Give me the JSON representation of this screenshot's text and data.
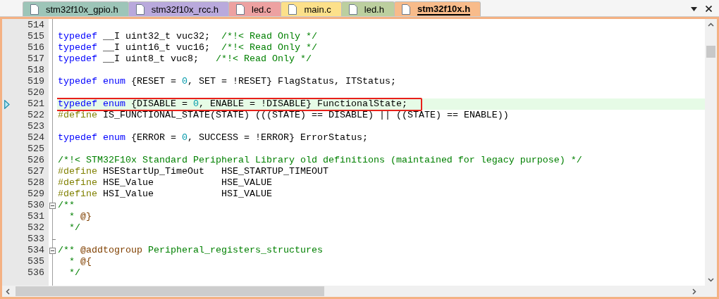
{
  "tabs": [
    {
      "label": "stm32f10x_gpio.h",
      "color": "#9dc5b8",
      "selected": false
    },
    {
      "label": "stm32f10x_rcc.h",
      "color": "#b9a9dc",
      "selected": false
    },
    {
      "label": "led.c",
      "color": "#eda1a1",
      "selected": false
    },
    {
      "label": "main.c",
      "color": "#fce08a",
      "selected": false
    },
    {
      "label": "led.h",
      "color": "#bccf9f",
      "selected": false
    },
    {
      "label": "stm32f10x.h",
      "color": "#f8bb8a",
      "selected": true
    }
  ],
  "lines": [
    {
      "number": "514",
      "current": false
    },
    {
      "number": "515",
      "current": false,
      "tokens": [
        {
          "text": "typedef",
          "kind": "keyword"
        },
        {
          "text": " __I uint32_t vuc32;  ",
          "kind": "plain"
        },
        {
          "text": "/*!< Read Only */",
          "kind": "comment"
        }
      ]
    },
    {
      "number": "516",
      "current": false,
      "tokens": [
        {
          "text": "typedef",
          "kind": "keyword"
        },
        {
          "text": " __I uint16_t vuc16;  ",
          "kind": "plain"
        },
        {
          "text": "/*!< Read Only */",
          "kind": "comment"
        }
      ]
    },
    {
      "number": "517",
      "current": false,
      "tokens": [
        {
          "text": "typedef",
          "kind": "keyword"
        },
        {
          "text": " __I uint8_t vuc8;   ",
          "kind": "plain"
        },
        {
          "text": "/*!< Read Only */",
          "kind": "comment"
        }
      ]
    },
    {
      "number": "518",
      "current": false
    },
    {
      "number": "519",
      "current": false,
      "tokens": [
        {
          "text": "typedef enum",
          "kind": "keyword"
        },
        {
          "text": " {RESET = ",
          "kind": "plain"
        },
        {
          "text": "0",
          "kind": "number"
        },
        {
          "text": ", SET = !RESET} FlagStatus, ITStatus;",
          "kind": "plain"
        }
      ]
    },
    {
      "number": "520",
      "current": false
    },
    {
      "number": "521",
      "current": true,
      "tokens": [
        {
          "text": "typedef enum",
          "kind": "keyword"
        },
        {
          "text": " {DISABLE = ",
          "kind": "plain"
        },
        {
          "text": "0",
          "kind": "number"
        },
        {
          "text": ", ENABLE = !DISABLE} FunctionalState;",
          "kind": "plain"
        }
      ]
    },
    {
      "number": "522",
      "current": false,
      "tokens": [
        {
          "text": "#define",
          "kind": "preprocessor"
        },
        {
          "text": " IS_FUNCTIONAL_STATE(STATE) (((STATE) == DISABLE) || ((STATE) == ENABLE))",
          "kind": "plain"
        }
      ]
    },
    {
      "number": "523",
      "current": false
    },
    {
      "number": "524",
      "current": false,
      "tokens": [
        {
          "text": "typedef enum",
          "kind": "keyword"
        },
        {
          "text": " {ERROR = ",
          "kind": "plain"
        },
        {
          "text": "0",
          "kind": "number"
        },
        {
          "text": ", SUCCESS = !ERROR} ErrorStatus;",
          "kind": "plain"
        }
      ]
    },
    {
      "number": "525",
      "current": false
    },
    {
      "number": "526",
      "current": false,
      "tokens": [
        {
          "text": "/*!< STM32F10x Standard Peripheral Library old definitions (maintained for legacy purpose) */",
          "kind": "comment"
        }
      ]
    },
    {
      "number": "527",
      "current": false,
      "tokens": [
        {
          "text": "#define",
          "kind": "preprocessor"
        },
        {
          "text": " HSEStartUp_TimeOut   HSE_STARTUP_TIMEOUT",
          "kind": "plain"
        }
      ]
    },
    {
      "number": "528",
      "current": false,
      "tokens": [
        {
          "text": "#define",
          "kind": "preprocessor"
        },
        {
          "text": " HSE_Value            HSE_VALUE",
          "kind": "plain"
        }
      ]
    },
    {
      "number": "529",
      "current": false,
      "tokens": [
        {
          "text": "#define",
          "kind": "preprocessor"
        },
        {
          "text": " HSI_Value            HSI_VALUE",
          "kind": "plain"
        }
      ]
    },
    {
      "number": "530",
      "current": false,
      "kind": "foldstart",
      "tokens": [
        {
          "text": "/**",
          "kind": "comment"
        }
      ]
    },
    {
      "number": "531",
      "current": false,
      "tokens": [
        {
          "text": "  * ",
          "kind": "comment"
        },
        {
          "text": "@}",
          "kind": "doctag"
        }
      ]
    },
    {
      "number": "532",
      "current": false,
      "tokens": [
        {
          "text": "  */",
          "kind": "comment"
        }
      ]
    },
    {
      "number": "533",
      "current": false,
      "kind": "foldend"
    },
    {
      "number": "534",
      "current": false,
      "kind": "foldstart",
      "tokens": [
        {
          "text": "/** ",
          "kind": "comment"
        },
        {
          "text": "@addtogroup",
          "kind": "doctag"
        },
        {
          "text": " Peripheral_registers_structures",
          "kind": "comment"
        }
      ]
    },
    {
      "number": "535",
      "current": false,
      "tokens": [
        {
          "text": "  * ",
          "kind": "comment"
        },
        {
          "text": "@{",
          "kind": "doctag"
        }
      ]
    },
    {
      "number": "536",
      "current": false,
      "tokens": [
        {
          "text": "  */",
          "kind": "comment"
        }
      ]
    }
  ]
}
